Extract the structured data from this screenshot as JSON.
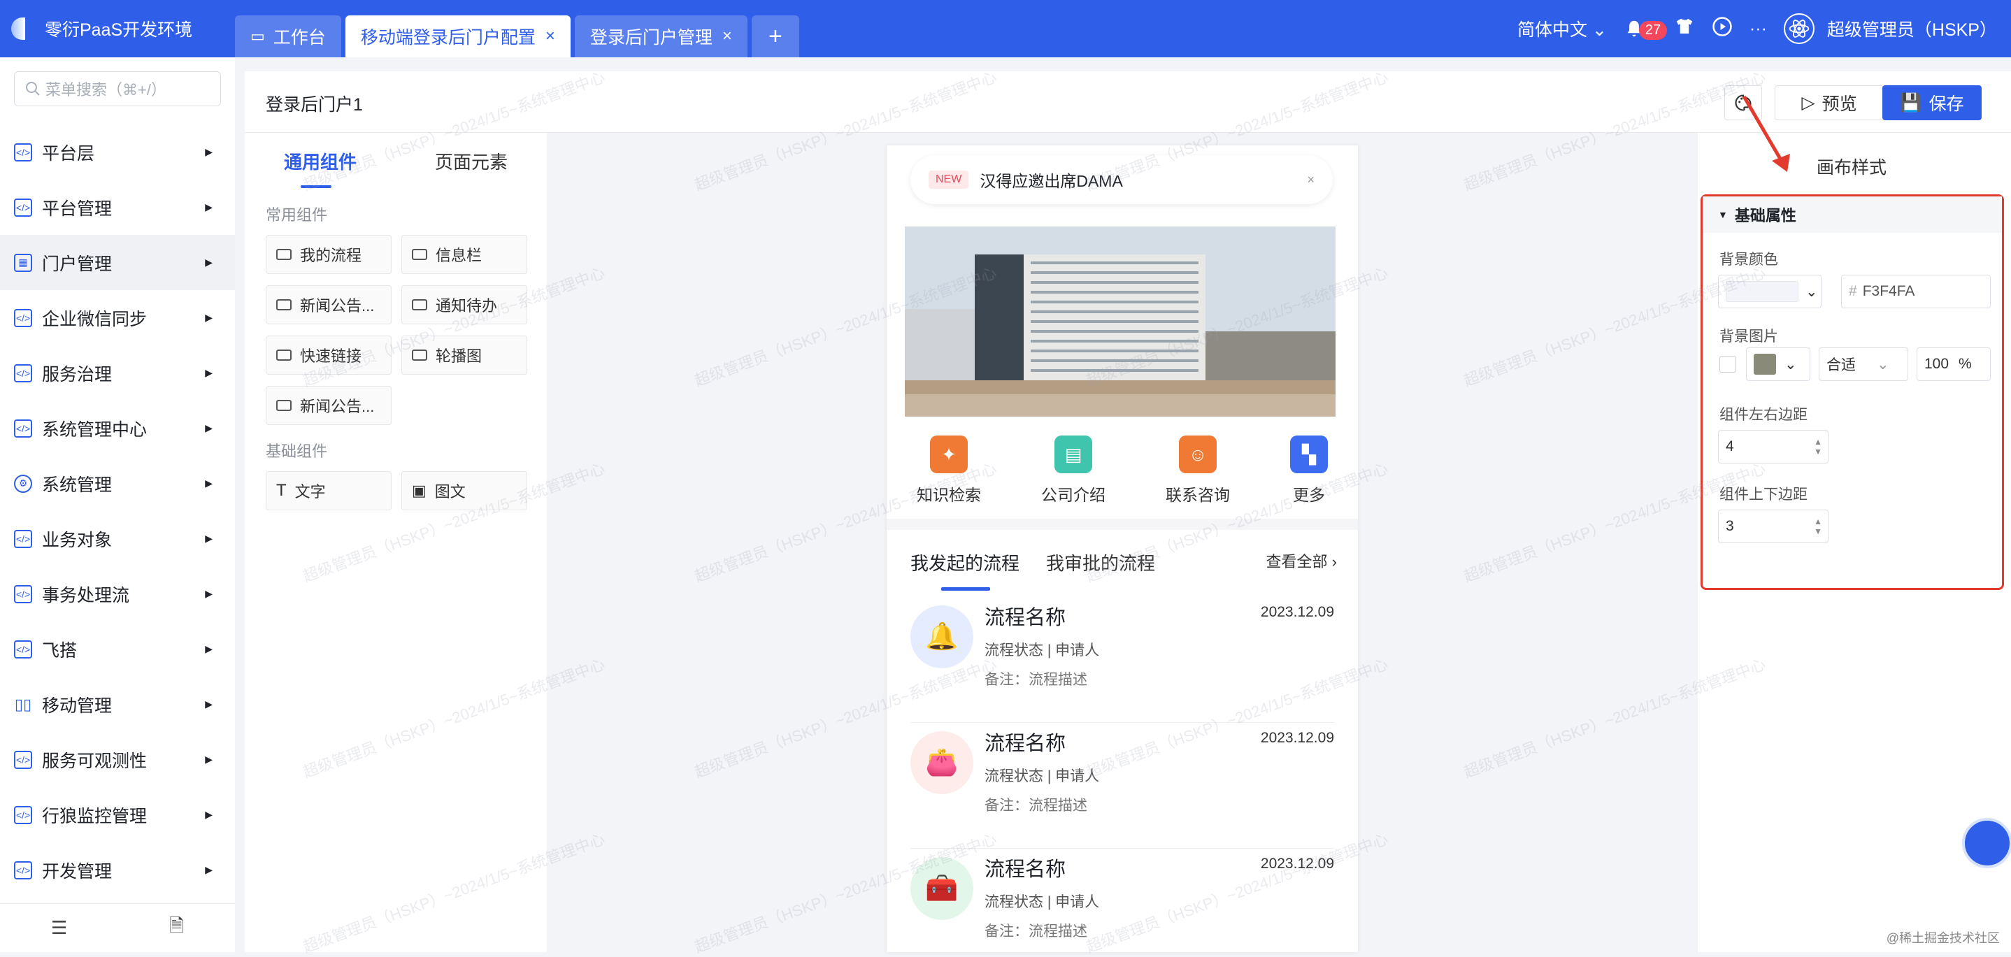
{
  "app": {
    "title": "零衍PaaS开发环境"
  },
  "tabs": [
    {
      "label": "工作台"
    },
    {
      "label": "移动端登录后门户配置",
      "close": "×"
    },
    {
      "label": "登录后门户管理",
      "close": "×"
    },
    {
      "label": "+"
    }
  ],
  "topright": {
    "lang": "简体中文",
    "notify_count": "27",
    "more": "···",
    "user": "超级管理员（HSKP）"
  },
  "search": {
    "placeholder": "菜单搜索（⌘+/）"
  },
  "menu": [
    {
      "label": "平台层"
    },
    {
      "label": "平台管理"
    },
    {
      "label": "门户管理"
    },
    {
      "label": "企业微信同步"
    },
    {
      "label": "服务治理"
    },
    {
      "label": "系统管理中心"
    },
    {
      "label": "系统管理"
    },
    {
      "label": "业务对象"
    },
    {
      "label": "事务处理流"
    },
    {
      "label": "飞搭"
    },
    {
      "label": "移动管理"
    },
    {
      "label": "服务可观测性"
    },
    {
      "label": "行狼监控管理"
    },
    {
      "label": "开发管理"
    }
  ],
  "page": {
    "title": "登录后门户1",
    "preview": "预览",
    "save": "保存"
  },
  "components": {
    "tabs": [
      "通用组件",
      "页面元素"
    ],
    "common_title": "常用组件",
    "common": [
      "我的流程",
      "信息栏",
      "新闻公告...",
      "通知待办",
      "快速链接",
      "轮播图",
      "新闻公告..."
    ],
    "basic_title": "基础组件",
    "basic": [
      "文字",
      "图文"
    ]
  },
  "phone": {
    "notice_tag": "NEW",
    "notice_text": "汉得应邀出席DAMA",
    "notice_close": "×",
    "shortcuts": [
      {
        "label": "知识检索",
        "color": "#f07a34"
      },
      {
        "label": "公司介绍",
        "color": "#3fc4ad"
      },
      {
        "label": "联系咨询",
        "color": "#f07a34"
      },
      {
        "label": "更多",
        "color": "#3d6cf0"
      }
    ],
    "tabs": [
      "我发起的流程",
      "我审批的流程"
    ],
    "view_all": "查看全部",
    "flows": [
      {
        "name": "流程名称",
        "date": "2023.12.09",
        "status": "流程状态",
        "applicant": "申请人",
        "remark": "备注：流程描述",
        "color": "#e6ecff"
      },
      {
        "name": "流程名称",
        "date": "2023.12.09",
        "status": "流程状态",
        "applicant": "申请人",
        "remark": "备注：流程描述",
        "color": "#fdecea"
      },
      {
        "name": "流程名称",
        "date": "2023.12.09",
        "status": "流程状态",
        "applicant": "申请人",
        "remark": "备注：流程描述",
        "color": "#e2f6ea"
      }
    ]
  },
  "props": {
    "canvas_style": "画布样式",
    "section": "基础属性",
    "bg_color_label": "背景颜色",
    "bg_color_value": "F3F4FA",
    "bg_image_label": "背景图片",
    "fit": "合适",
    "scale": "100",
    "scale_unit": "%",
    "lr_label": "组件左右边距",
    "lr_value": "4",
    "tb_label": "组件上下边距",
    "tb_value": "3"
  },
  "watermark": "超级管理员（HSKP）~2024/1/5~系统管理中心",
  "credit": "@稀土掘金技术社区"
}
